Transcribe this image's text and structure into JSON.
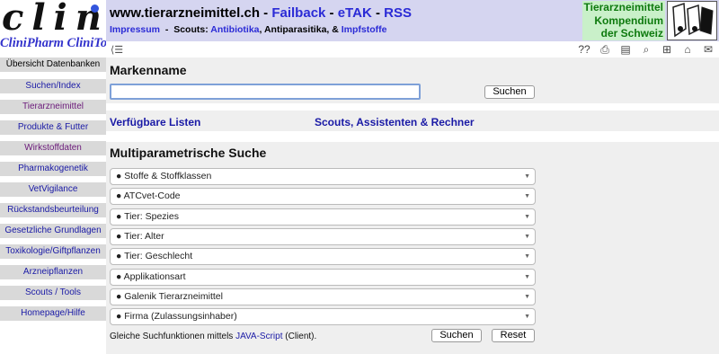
{
  "logo": {
    "wordmark": "clini",
    "brand": "CliniPharm CliniTox"
  },
  "sidebar": {
    "overview": "Übersicht Datenbanken",
    "items": [
      {
        "label": "Suchen/Index"
      },
      {
        "label": "Tierarzneimittel"
      },
      {
        "label": "Produkte & Futter"
      },
      {
        "label": "Wirkstoffdaten"
      },
      {
        "label": "Pharmakogenetik"
      },
      {
        "label": "VetVigilance"
      },
      {
        "label": "Rückstandsbeurteilung"
      },
      {
        "label": "Gesetzliche Grundlagen"
      },
      {
        "label": "Toxikologie/Giftpflanzen"
      },
      {
        "label": "Arzneipflanzen"
      },
      {
        "label": "Scouts / Tools"
      },
      {
        "label": "Homepage/Hilfe"
      }
    ]
  },
  "header": {
    "site": "www.tierarzneimittel.ch",
    "sep": "-",
    "failback": "Failback",
    "etak": "eTAK",
    "rss": "RSS",
    "impressum": "Impressum",
    "scouts_prefix": "Scouts:",
    "antibiotika": "Antibiotika",
    "antiparasitika": "Antiparasitika,",
    "amp": "&",
    "impfstoffe": "Impfstoffe",
    "kompendium": [
      "Tierarzneimittel",
      "Kompendium",
      "der Schweiz"
    ]
  },
  "toolbar": {
    "back": "⟨☰",
    "icons": [
      "??",
      "⎙",
      "▤",
      "⌕",
      "⊞",
      "⌂",
      "✉"
    ]
  },
  "main": {
    "markenname_title": "Markenname",
    "search_button": "Suchen",
    "lists_link": "Verfügbare Listen",
    "scouts_link": "Scouts, Assistenten & Rechner",
    "multi_title": "Multiparametrische Suche",
    "selects": [
      "● Stoffe & Stoffklassen",
      "● ATCvet-Code",
      "● Tier: Spezies",
      "● Tier: Alter",
      "● Tier: Geschlecht",
      "● Applikationsart",
      "● Galenik Tierarzneimittel",
      "● Firma (Zulassungsinhaber)"
    ],
    "footnote_text": "Gleiche Suchfunktionen mittels",
    "footnote_link": "JAVA-Script",
    "footnote_suffix": "(Client).",
    "search_button2": "Suchen",
    "reset_button": "Reset"
  },
  "colors": {
    "header_bg": "#d5d5f0",
    "link": "#1a1aa6",
    "kompendium": "#0e7a0e"
  }
}
